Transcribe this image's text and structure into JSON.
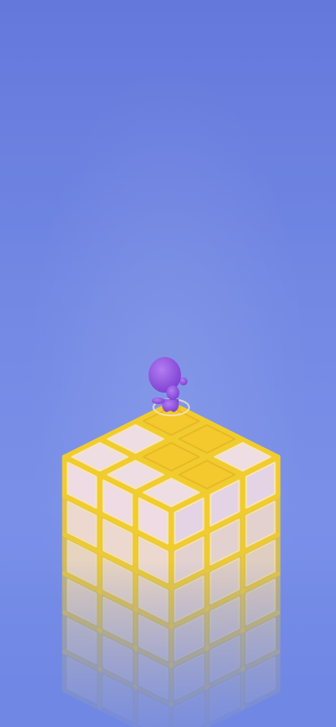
{
  "game": {
    "background_top_color": "#6478dc",
    "background_bottom_color": "#7a90e8",
    "tile_visited_color": "#f3c92e",
    "tile_unvisited_color": "#efdde4",
    "tile_edge_color": "#f1cc2f",
    "character_color": "#8a4bd8",
    "grid_size": 3,
    "top_tiles_visited": [
      [
        true,
        true,
        false
      ],
      [
        false,
        true,
        true
      ],
      [
        false,
        false,
        false
      ]
    ],
    "character_tile": [
      0,
      0
    ]
  }
}
